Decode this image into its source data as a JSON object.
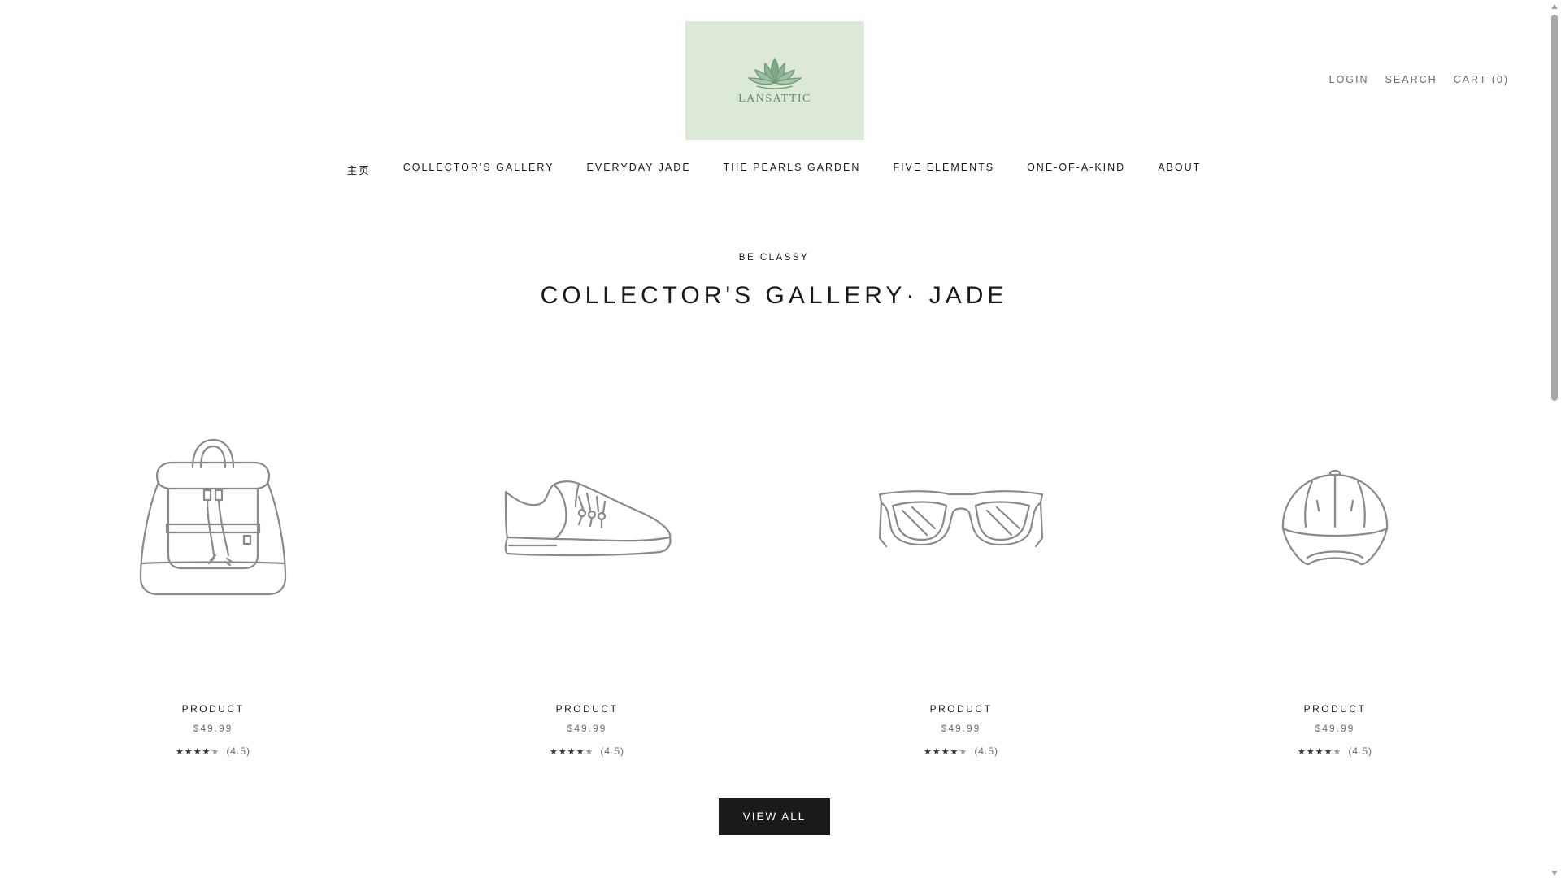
{
  "brand": {
    "name": "LANSATTIC",
    "logo_icon": "lotus-icon",
    "logo_bg": "#dce9d9",
    "accent": "#5f8a6a"
  },
  "top_actions": {
    "login": "LOGIN",
    "search": "SEARCH",
    "cart": "CART (0)"
  },
  "nav": {
    "items": [
      {
        "label": "主页"
      },
      {
        "label": "COLLECTOR'S GALLERY"
      },
      {
        "label": "EVERYDAY JADE"
      },
      {
        "label": "THE PEARLS GARDEN"
      },
      {
        "label": "FIVE ELEMENTS"
      },
      {
        "label": "ONE-OF-A-KIND"
      },
      {
        "label": "ABOUT"
      }
    ]
  },
  "section": {
    "eyebrow": "BE CLASSY",
    "title": "COLLECTOR'S GALLERY· JADE"
  },
  "products": [
    {
      "icon": "backpack-icon",
      "name": "PRODUCT",
      "price": "$49.99",
      "rating_value": 4.5,
      "rating_text": "(4.5)"
    },
    {
      "icon": "sneaker-icon",
      "name": "PRODUCT",
      "price": "$49.99",
      "rating_value": 4.5,
      "rating_text": "(4.5)"
    },
    {
      "icon": "sunglasses-icon",
      "name": "PRODUCT",
      "price": "$49.99",
      "rating_value": 4.5,
      "rating_text": "(4.5)"
    },
    {
      "icon": "cap-icon",
      "name": "PRODUCT",
      "price": "$49.99",
      "rating_value": 4.5,
      "rating_text": "(4.5)"
    }
  ],
  "view_all": "VIEW ALL",
  "colors": {
    "text": "#1a1a1a",
    "muted": "#6b6b6b",
    "button_bg": "#1a1a1a",
    "button_text": "#ffffff"
  }
}
